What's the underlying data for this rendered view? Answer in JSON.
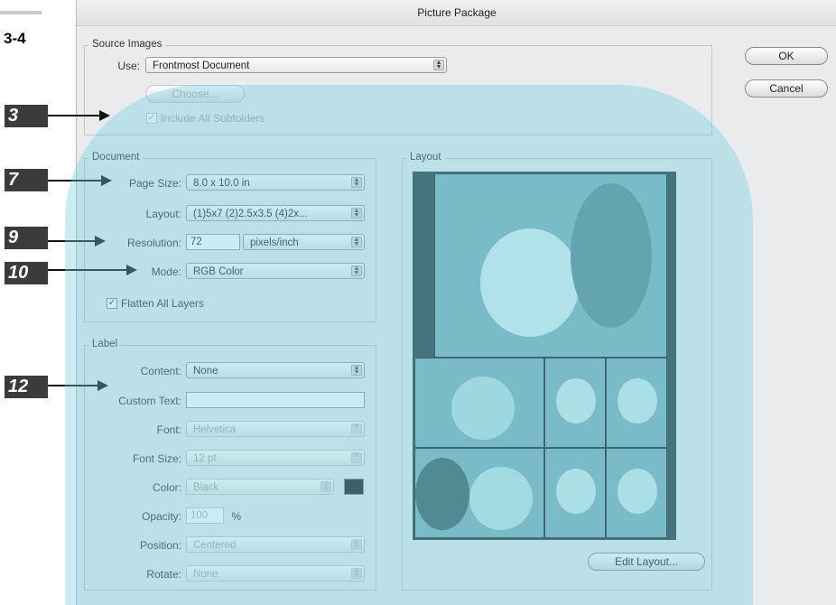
{
  "figure_label": "3-4",
  "window": {
    "title": "Picture Package"
  },
  "buttons": {
    "ok": "OK",
    "cancel": "Cancel",
    "choose": "Choose...",
    "edit_layout": "Edit Layout..."
  },
  "source_images": {
    "title": "Source Images",
    "use_label": "Use:",
    "use_value": "Frontmost Document",
    "include_subfolders_label": "Include All Subfolders",
    "include_subfolders_checked": true
  },
  "document": {
    "title": "Document",
    "page_size_label": "Page Size:",
    "page_size_value": "8.0 x 10.0 in",
    "layout_label": "Layout:",
    "layout_value": "(1)5x7 (2)2.5x3.5 (4)2x...",
    "resolution_label": "Resolution:",
    "resolution_value": "72",
    "resolution_unit": "pixels/inch",
    "mode_label": "Mode:",
    "mode_value": "RGB Color",
    "flatten_label": "Flatten All Layers",
    "flatten_checked": true
  },
  "label_group": {
    "title": "Label",
    "content_label": "Content:",
    "content_value": "None",
    "custom_text_label": "Custom Text:",
    "custom_text_value": "",
    "font_label": "Font:",
    "font_value": "Helvetica",
    "font_size_label": "Font Size:",
    "font_size_value": "12 pt",
    "color_label": "Color:",
    "color_value": "Black",
    "color_swatch": "#1e1e1e",
    "opacity_label": "Opacity:",
    "opacity_value": "100",
    "opacity_unit": "%",
    "position_label": "Position:",
    "position_value": "Centered",
    "rotate_label": "Rotate:",
    "rotate_value": "None"
  },
  "layout_group": {
    "title": "Layout"
  },
  "callouts": [
    "3",
    "7",
    "9",
    "10",
    "12"
  ],
  "colors": {
    "callout_bg": "#3b3b3b",
    "overlay": "#72d0e0",
    "dialog_bg": "#e9ebed"
  }
}
